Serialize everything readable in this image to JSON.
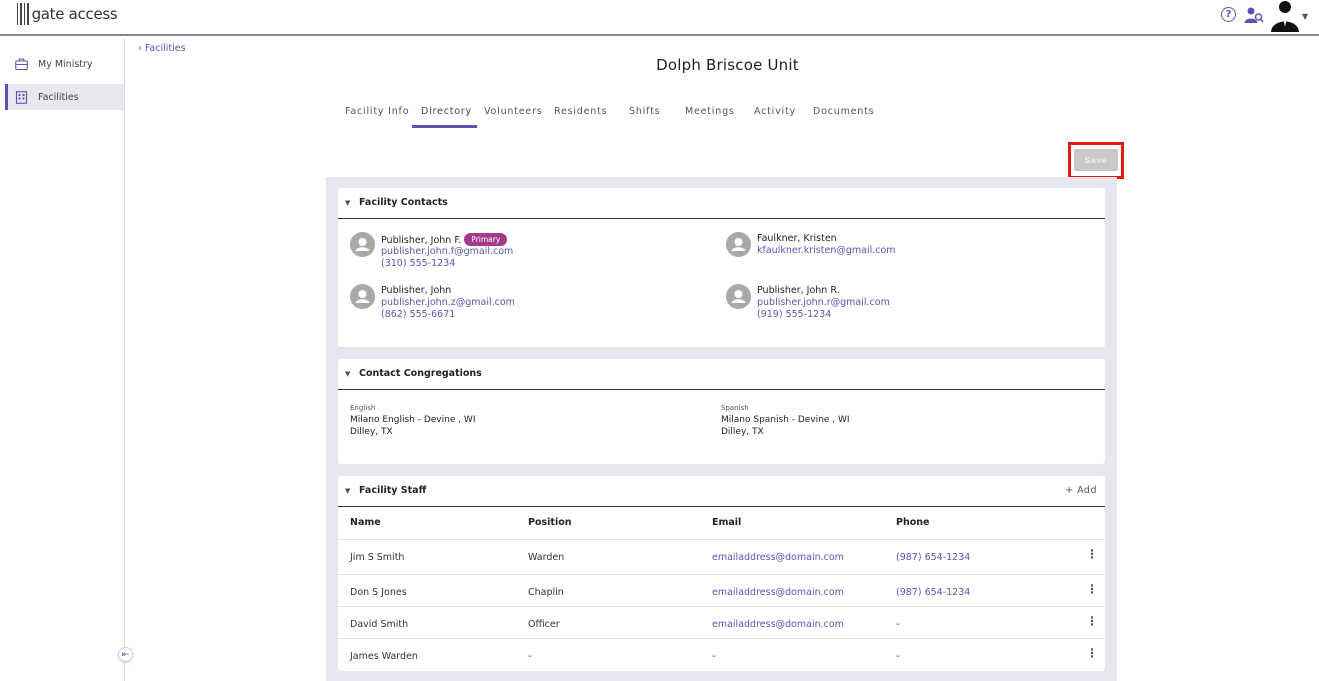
{
  "header": {
    "logo_text": "gate access",
    "help_glyph": "?",
    "icons": [
      "help-icon",
      "people-search-icon",
      "user-avatar"
    ]
  },
  "sidebar": {
    "items": [
      {
        "label": "My Ministry",
        "icon": "briefcase-icon",
        "active": false
      },
      {
        "label": "Facilities",
        "icon": "building-icon",
        "active": true
      }
    ],
    "collapse_glyph": "⇤"
  },
  "breadcrumb": {
    "back_label": "‹ Facilities"
  },
  "page": {
    "title": "Dolph Briscoe Unit"
  },
  "tabs": [
    {
      "label": "Facility Info"
    },
    {
      "label": "Directory",
      "active": true
    },
    {
      "label": "Volunteers"
    },
    {
      "label": "Residents"
    },
    {
      "label": "Shifts"
    },
    {
      "label": "Meetings"
    },
    {
      "label": "Activity"
    },
    {
      "label": "Documents"
    }
  ],
  "actions": {
    "save_label": "Save"
  },
  "facility_contacts": {
    "title": "Facility Contacts",
    "contacts": [
      {
        "name": "Publisher, John F.",
        "badge": "Primary",
        "email": "publisher.john.f@gmail.com",
        "phone": "(310) 555-1234"
      },
      {
        "name": "Faulkner, Kristen",
        "email": "kfaulkner.kristen@gmail.com"
      },
      {
        "name": "Publisher, John",
        "email": "publisher.john.z@gmail.com",
        "phone": "(862) 555-6671"
      },
      {
        "name": "Publisher, John R.",
        "email": "publisher.john.r@gmail.com",
        "phone": "(919) 555-1234"
      }
    ]
  },
  "contact_congregations": {
    "title": "Contact Congregations",
    "items": [
      {
        "language": "English",
        "name": "Milano English - Devine , WI",
        "city": "Dilley, TX"
      },
      {
        "language": "Spanish",
        "name": "Milano Spanish - Devine , WI",
        "city": "Dilley, TX"
      }
    ]
  },
  "facility_staff": {
    "title": "Facility Staff",
    "add_label": "+ Add",
    "columns": [
      "Name",
      "Position",
      "Email",
      "Phone"
    ],
    "rows": [
      {
        "name": "Jim S Smith",
        "position": "Warden",
        "email": "emailaddress@domain.com",
        "phone": "(987) 654-1234"
      },
      {
        "name": "Don S Jones",
        "position": "Chaplin",
        "email": "emailaddress@domain.com",
        "phone": "(987) 654-1234"
      },
      {
        "name": "David Smith",
        "position": "Officer",
        "email": "emailaddress@domain.com",
        "phone": "-"
      },
      {
        "name": "James Warden",
        "position": "-",
        "email": "-",
        "phone": "-"
      }
    ],
    "row_menu_glyph": "⋮"
  },
  "colors": {
    "accent": "#5b55b0",
    "badge": "#a33a8c",
    "highlight": "#e21b0c"
  }
}
